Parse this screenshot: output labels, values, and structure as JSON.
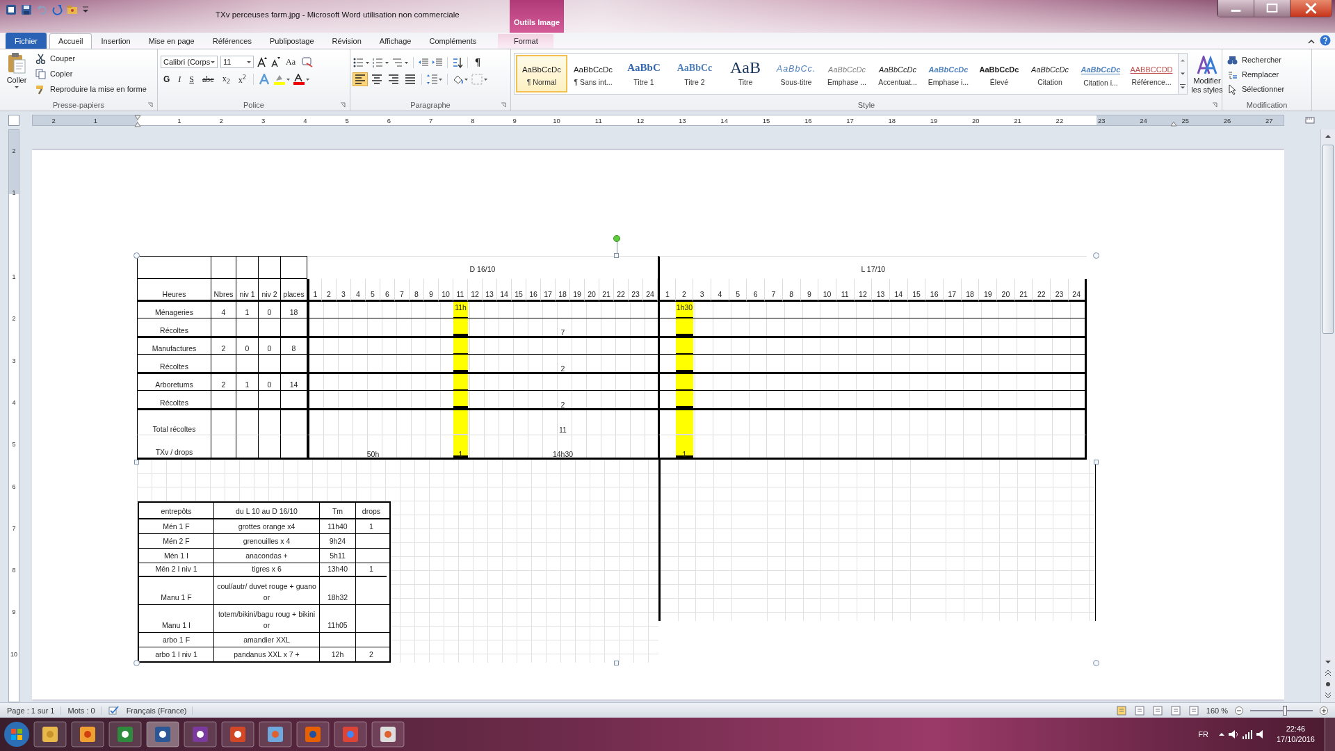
{
  "window": {
    "title": "TXv perceuses farm.jpg  -  Microsoft Word utilisation non commerciale",
    "contextual_group": "Outils Image"
  },
  "ribbon_tabs": [
    {
      "label": "Fichier",
      "kind": "file",
      "selected": false
    },
    {
      "label": "Accueil",
      "kind": "normal",
      "selected": true
    },
    {
      "label": "Insertion",
      "kind": "normal",
      "selected": false
    },
    {
      "label": "Mise en page",
      "kind": "normal",
      "selected": false
    },
    {
      "label": "Références",
      "kind": "normal",
      "selected": false
    },
    {
      "label": "Publipostage",
      "kind": "normal",
      "selected": false
    },
    {
      "label": "Révision",
      "kind": "normal",
      "selected": false
    },
    {
      "label": "Affichage",
      "kind": "normal",
      "selected": false
    },
    {
      "label": "Compléments",
      "kind": "normal",
      "selected": false
    },
    {
      "label": "Format",
      "kind": "contextual",
      "selected": false
    }
  ],
  "clipboard": {
    "paste": "Coller",
    "items": [
      "Couper",
      "Copier",
      "Reproduire la mise en forme"
    ],
    "group_label": "Presse-papiers"
  },
  "font": {
    "name": "Calibri (Corps",
    "size": "11",
    "case_button": "Aa",
    "format_buttons": [
      "G",
      "I",
      "S",
      "abc",
      "x$_{2}$",
      "x$^{2}$"
    ],
    "group_label": "Police"
  },
  "paragraph": {
    "show_marks": "¶",
    "alignments": [
      {
        "selected": true
      },
      {
        "selected": false
      },
      {
        "selected": false
      },
      {
        "selected": false
      }
    ],
    "group_label": "Paragraphe"
  },
  "styles": {
    "items": [
      {
        "preview": "AaBbCcDc",
        "label": "¶ Normal",
        "kind": "plain",
        "selected": true
      },
      {
        "preview": "AaBbCcDc",
        "label": "¶ Sans int...",
        "kind": "plain",
        "selected": false
      },
      {
        "preview": "AaBbC",
        "label": "Titre 1",
        "kind": "heading1",
        "selected": false
      },
      {
        "preview": "AaBbCc",
        "label": "Titre 2",
        "kind": "heading2",
        "selected": false
      },
      {
        "preview": "AaB",
        "label": "Titre",
        "kind": "title",
        "selected": false
      },
      {
        "preview": "AaBbCc.",
        "label": "Sous-titre",
        "kind": "subtitle",
        "selected": false
      },
      {
        "preview": "AaBbCcDc",
        "label": "Emphase ...",
        "kind": "subtle",
        "selected": false
      },
      {
        "preview": "AaBbCcDc",
        "label": "Accentuat...",
        "kind": "emphasis",
        "selected": false
      },
      {
        "preview": "AaBbCcDc",
        "label": "Emphase i...",
        "kind": "intense",
        "selected": false
      },
      {
        "preview": "AaBbCcDc",
        "label": "Élevé",
        "kind": "strong",
        "selected": false
      },
      {
        "preview": "AaBbCcDc",
        "label": "Citation",
        "kind": "quote",
        "selected": false
      },
      {
        "preview": "AaBbCcDc",
        "label": "Citation i...",
        "kind": "intense-quote",
        "selected": false
      },
      {
        "preview": "AABBCCDD",
        "label": "Référence...",
        "kind": "reference",
        "selected": false
      }
    ],
    "modify": "Modifier les styles",
    "group_label": "Style"
  },
  "editing": {
    "items": [
      "Rechercher",
      "Remplacer",
      "Sélectionner"
    ],
    "group_label": "Modification"
  },
  "ruler": {
    "labels": [
      "2",
      "1",
      "1",
      "2",
      "3",
      "4",
      "5",
      "6",
      "7",
      "8",
      "9",
      "10",
      "11",
      "12",
      "13",
      "14",
      "15",
      "16",
      "17",
      "18",
      "19",
      "20",
      "21",
      "22",
      "23",
      "24",
      "25",
      "26",
      "27"
    ],
    "vertical_labels": [
      "2",
      "1",
      "1",
      "2",
      "3",
      "4",
      "5",
      "6",
      "7",
      "8",
      "9",
      "10"
    ]
  },
  "schedule": {
    "header_columns": [
      "Heures",
      "Nbres",
      "niv 1",
      "niv 2",
      "places"
    ],
    "days": [
      {
        "label": "D 16/10",
        "hours": [
          {
            "label": "1",
            "highlighted": false
          },
          {
            "label": "2",
            "highlighted": false
          },
          {
            "label": "3",
            "highlighted": false
          },
          {
            "label": "4",
            "highlighted": false
          },
          {
            "label": "5",
            "highlighted": false
          },
          {
            "label": "6",
            "highlighted": false
          },
          {
            "label": "7",
            "highlighted": false
          },
          {
            "label": "8",
            "highlighted": false
          },
          {
            "label": "9",
            "highlighted": false
          },
          {
            "label": "10",
            "highlighted": false
          },
          {
            "label": "11",
            "highlighted": true
          },
          {
            "label": "12",
            "highlighted": false
          },
          {
            "label": "13",
            "highlighted": false
          },
          {
            "label": "14",
            "highlighted": false
          },
          {
            "label": "15",
            "highlighted": false
          },
          {
            "label": "16",
            "highlighted": false
          },
          {
            "label": "17",
            "highlighted": false
          },
          {
            "label": "18",
            "highlighted": false
          },
          {
            "label": "19",
            "highlighted": false
          },
          {
            "label": "20",
            "highlighted": false
          },
          {
            "label": "21",
            "highlighted": false
          },
          {
            "label": "22",
            "highlighted": false
          },
          {
            "label": "23",
            "highlighted": false
          },
          {
            "label": "24",
            "highlighted": false
          }
        ]
      },
      {
        "label": "L 17/10",
        "hours": [
          {
            "label": "1",
            "highlighted": false
          },
          {
            "label": "2",
            "highlighted": true
          },
          {
            "label": "3",
            "highlighted": false
          },
          {
            "label": "4",
            "highlighted": false
          },
          {
            "label": "5",
            "highlighted": false
          },
          {
            "label": "6",
            "highlighted": false
          },
          {
            "label": "7",
            "highlighted": false
          },
          {
            "label": "8",
            "highlighted": false
          },
          {
            "label": "9",
            "highlighted": false
          },
          {
            "label": "10",
            "highlighted": false
          },
          {
            "label": "11",
            "highlighted": false
          },
          {
            "label": "12",
            "highlighted": false
          },
          {
            "label": "13",
            "highlighted": false
          },
          {
            "label": "14",
            "highlighted": false
          },
          {
            "label": "15",
            "highlighted": false
          },
          {
            "label": "16",
            "highlighted": false
          },
          {
            "label": "17",
            "highlighted": false
          },
          {
            "label": "18",
            "highlighted": false
          },
          {
            "label": "19",
            "highlighted": false
          },
          {
            "label": "20",
            "highlighted": false
          },
          {
            "label": "21",
            "highlighted": false
          },
          {
            "label": "22",
            "highlighted": false
          },
          {
            "label": "23",
            "highlighted": false
          },
          {
            "label": "24",
            "highlighted": false
          }
        ]
      }
    ],
    "rows": [
      {
        "label": "Ménageries",
        "kind": "site",
        "values": [
          "4",
          "1",
          "0",
          "18"
        ],
        "days": [
          [
            "11h"
          ],
          [
            "1h30"
          ]
        ]
      },
      {
        "label": "Récoltes",
        "kind": "harvest",
        "days": [
          [
            "7"
          ]
        ]
      },
      {
        "label": "Manufactures",
        "kind": "site",
        "values": [
          "2",
          "0",
          "0",
          "8"
        ]
      },
      {
        "label": "Récoltes",
        "kind": "harvest",
        "days": [
          [
            "2"
          ]
        ]
      },
      {
        "label": "Arboretums",
        "kind": "site",
        "values": [
          "2",
          "1",
          "0",
          "14"
        ]
      },
      {
        "label": "Récoltes",
        "kind": "harvest",
        "days": [
          [
            "2"
          ]
        ]
      },
      {
        "label": "Total récoltes",
        "kind": "total",
        "days": [
          [
            "11"
          ]
        ]
      },
      {
        "label": "TXv / drops",
        "kind": "drops",
        "days": [
          [
            "50h",
            "1",
            "14h30"
          ],
          [
            "1"
          ]
        ]
      }
    ]
  },
  "warehouse_table": {
    "columns": [
      "entrepôts",
      "du L 10 au D 16/10",
      "Tm",
      "drops"
    ],
    "rows": [
      {
        "site": "Mén 1 F",
        "contents": "grottes orange x4",
        "tm": "11h40",
        "drops": "1"
      },
      {
        "site": "Mén 2 F",
        "contents": "grenouilles x 4",
        "tm": "9h24"
      },
      {
        "site": "Mén 1 I",
        "contents": "anacondas +",
        "tm": "5h11"
      },
      {
        "site": "Mén  2 I niv 1",
        "contents": "tigres x 6",
        "tm": "13h40",
        "drops": "1",
        "group_end": true
      },
      {
        "site": "Manu  1 F",
        "contents": "coul/autr/ duvet rouge + guano or",
        "tm": "18h32"
      },
      {
        "site": "Manu 1 I",
        "contents": "totem/bikini/bagu roug + bikini or",
        "tm": "11h05"
      },
      {
        "site": "arbo 1 F",
        "contents": "amandier XXL"
      },
      {
        "site": "arbo 1 I niv 1",
        "contents": "pandanus XXL x 7 +",
        "tm": "12h",
        "drops": "2"
      }
    ]
  },
  "status_bar": {
    "page": "Page : 1 sur 1",
    "words": "Mots : 0",
    "language": "Français (France)",
    "zoom": {
      "label": "160 %"
    }
  },
  "taskbar": {
    "language": "FR",
    "time": "22:46",
    "date": "17/10/2016"
  }
}
